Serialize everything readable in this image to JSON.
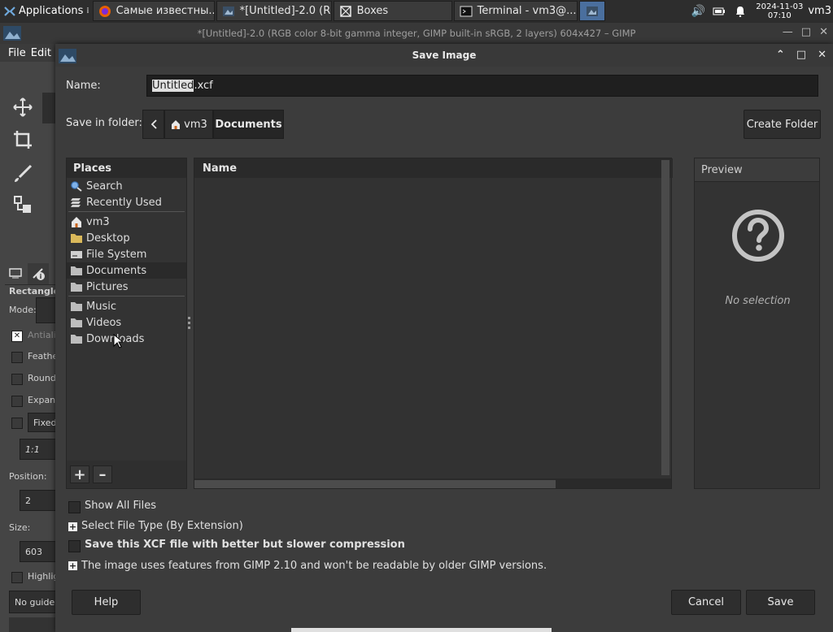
{
  "taskbar": {
    "applications": "Applications",
    "items": [
      {
        "label": "Самые известны..."
      },
      {
        "label": "*[Untitled]-2.0 (R..."
      },
      {
        "label": "Boxes"
      },
      {
        "label": "Terminal - vm3@..."
      }
    ],
    "clock_date": "2024-11-03",
    "clock_time": "07:10",
    "user": "vm3"
  },
  "gimp": {
    "title": "*[Untitled]-2.0 (RGB color 8-bit gamma integer, GIMP built-in sRGB, 2 layers) 604x427 – GIMP",
    "menu_file": "File",
    "menu_edit": "Edit",
    "tool_options": {
      "title": "Rectangle",
      "mode_label": "Mode:",
      "antialias": "Antialias",
      "feather": "Feathe",
      "rounded": "Round",
      "expand": "Expan",
      "fixed": "Fixed",
      "ratio": "1:1",
      "position_label": "Position:",
      "position_value": "2",
      "size_label": "Size:",
      "size_value": "603",
      "highlight": "Highlig",
      "guides": "No guide"
    }
  },
  "dialog": {
    "title": "Save Image",
    "name_label": "Name:",
    "name_selected": "Untitled",
    "name_ext": ".xcf",
    "folder_label": "Save in folder:",
    "crumbs": [
      "vm3",
      "Documents"
    ],
    "create_folder": "Create Folder",
    "places_header": "Places",
    "places_group1": [
      "Search",
      "Recently Used"
    ],
    "places_group2": [
      "vm3",
      "Desktop",
      "File System",
      "Documents",
      "Pictures"
    ],
    "places_group3": [
      "Music",
      "Videos",
      "Downloads"
    ],
    "files_header": "Name",
    "preview_header": "Preview",
    "no_selection": "No selection",
    "show_all_files": "Show All Files",
    "select_file_type": "Select File Type (By Extension)",
    "compression": "Save this XCF file with better but slower compression",
    "compat_note": "The image uses features from GIMP 2.10 and won't be readable by older GIMP versions.",
    "help": "Help",
    "cancel": "Cancel",
    "save": "Save"
  }
}
